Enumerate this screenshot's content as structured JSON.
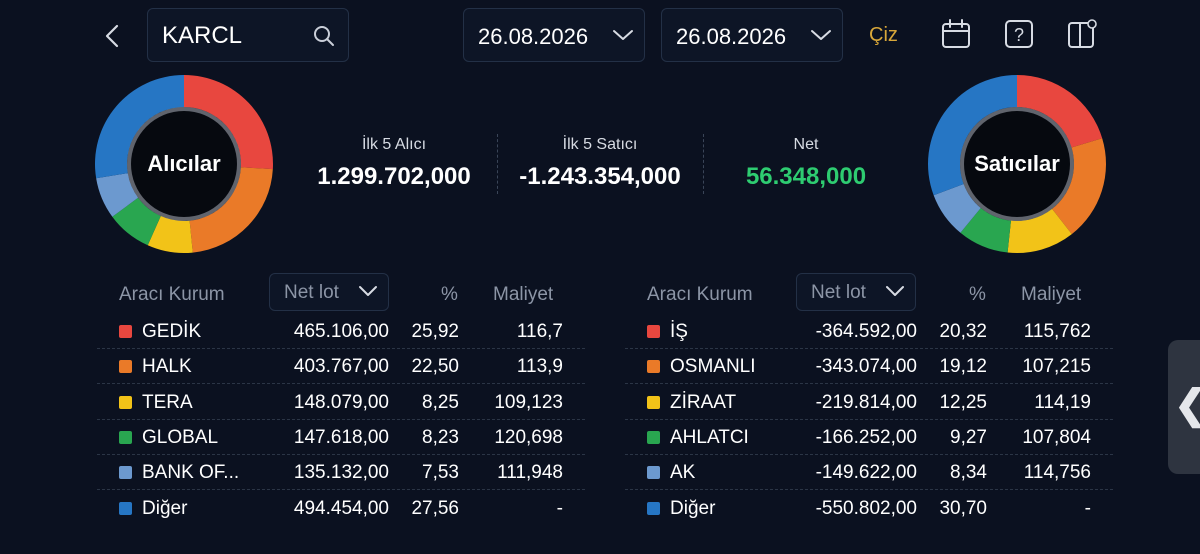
{
  "search": {
    "value": "KARCL"
  },
  "dates": {
    "start": "26.08.2026",
    "end": "26.08.2026"
  },
  "draw_label": "Çiz",
  "donuts": {
    "buyers_label": "Alıcılar",
    "sellers_label": "Satıcılar"
  },
  "summary": {
    "buy_label": "İlk 5 Alıcı",
    "buy_value": "1.299.702,000",
    "sell_label": "İlk 5 Satıcı",
    "sell_value": "-1.243.354,000",
    "net_label": "Net",
    "net_value": "56.348,000"
  },
  "colors": {
    "red": "#e8473f",
    "orange": "#ea7a28",
    "yellow": "#f2c318",
    "green": "#29a650",
    "lightblue": "#6c99cf",
    "blue": "#2676c4",
    "net_green": "#2ecc71"
  },
  "buyers_table": {
    "headers": {
      "broker": "Aracı Kurum",
      "netlot": "Net lot",
      "pct": "%",
      "cost": "Maliyet"
    },
    "rows": [
      {
        "name": "GEDİK",
        "lot": "465.106,00",
        "pct": "25,92",
        "cost": "116,7",
        "color": "#e8473f"
      },
      {
        "name": "HALK",
        "lot": "403.767,00",
        "pct": "22,50",
        "cost": "113,9",
        "color": "#ea7a28"
      },
      {
        "name": "TERA",
        "lot": "148.079,00",
        "pct": "8,25",
        "cost": "109,123",
        "color": "#f2c318"
      },
      {
        "name": "GLOBAL",
        "lot": "147.618,00",
        "pct": "8,23",
        "cost": "120,698",
        "color": "#29a650"
      },
      {
        "name": "BANK OF...",
        "lot": "135.132,00",
        "pct": "7,53",
        "cost": "111,948",
        "color": "#6c99cf"
      },
      {
        "name": "Diğer",
        "lot": "494.454,00",
        "pct": "27,56",
        "cost": "-",
        "color": "#2676c4"
      }
    ]
  },
  "sellers_table": {
    "headers": {
      "broker": "Aracı Kurum",
      "netlot": "Net lot",
      "pct": "%",
      "cost": "Maliyet"
    },
    "rows": [
      {
        "name": "İŞ",
        "lot": "-364.592,00",
        "pct": "20,32",
        "cost": "115,762",
        "color": "#e8473f"
      },
      {
        "name": "OSMANLI",
        "lot": "-343.074,00",
        "pct": "19,12",
        "cost": "107,215",
        "color": "#ea7a28"
      },
      {
        "name": "ZİRAAT",
        "lot": "-219.814,00",
        "pct": "12,25",
        "cost": "114,19",
        "color": "#f2c318"
      },
      {
        "name": "AHLATCI",
        "lot": "-166.252,00",
        "pct": "9,27",
        "cost": "107,804",
        "color": "#29a650"
      },
      {
        "name": "AK",
        "lot": "-149.622,00",
        "pct": "8,34",
        "cost": "114,756",
        "color": "#6c99cf"
      },
      {
        "name": "Diğer",
        "lot": "-550.802,00",
        "pct": "30,70",
        "cost": "-",
        "color": "#2676c4"
      }
    ]
  }
}
